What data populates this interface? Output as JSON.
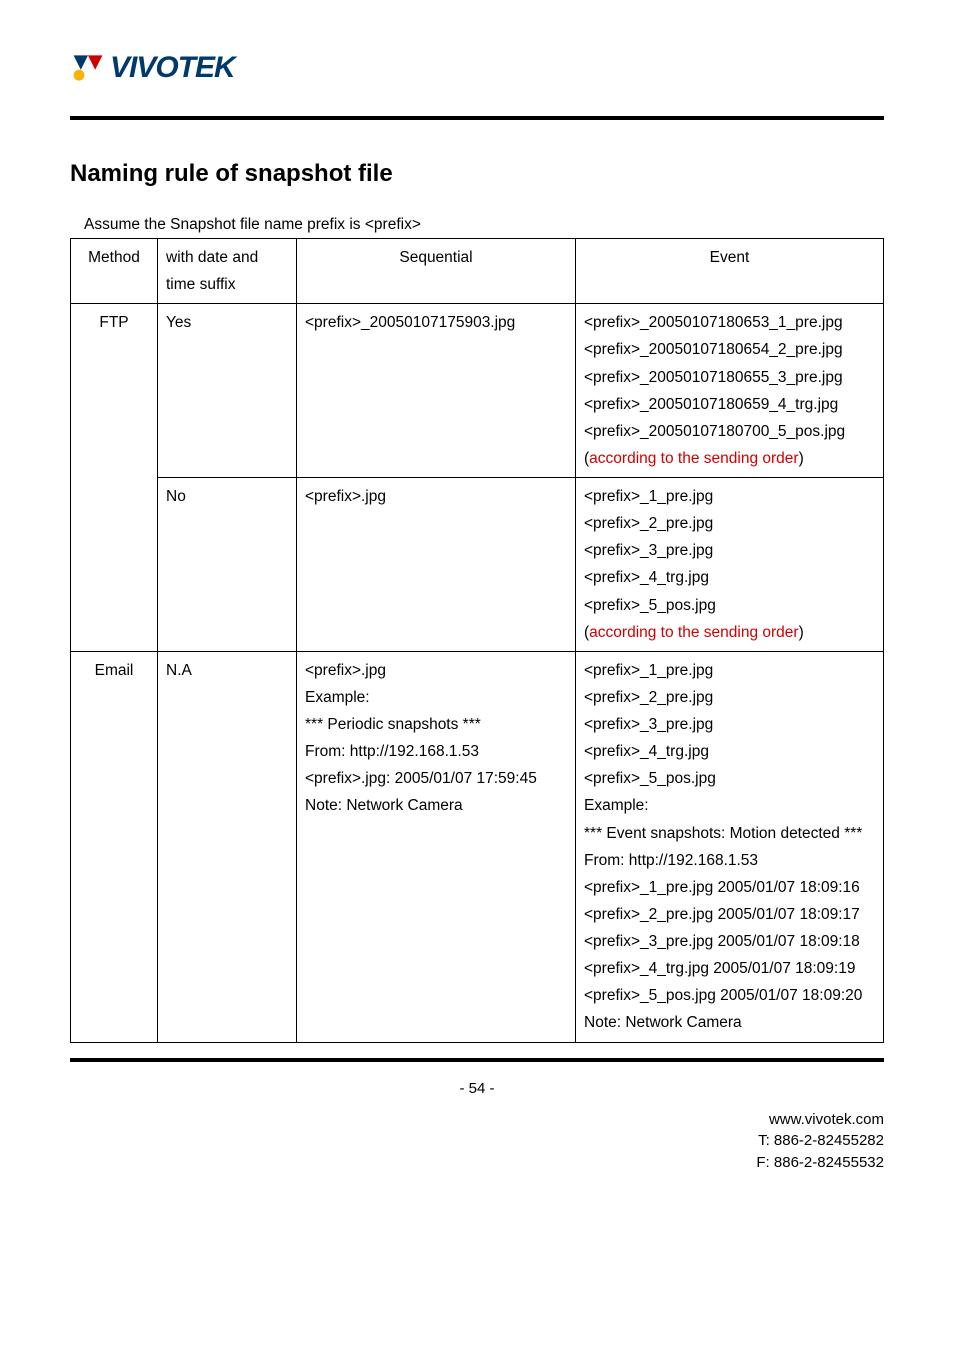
{
  "logo_text": "VIVOTEK",
  "section_title": "Naming rule of snapshot file",
  "assume_text": "Assume the Snapshot file name prefix is <prefix>",
  "table": {
    "headers": {
      "method": "Method",
      "suffix": "with date and time suffix",
      "sequential": "Sequential",
      "event": "Event"
    },
    "rows": [
      {
        "method": "FTP",
        "suffix": "Yes",
        "sequential": "<prefix>_20050107175903.jpg",
        "event_lines": [
          "<prefix>_20050107180653_1_pre.jpg",
          "<prefix>_20050107180654_2_pre.jpg",
          "<prefix>_20050107180655_3_pre.jpg",
          "<prefix>_20050107180659_4_trg.jpg",
          "<prefix>_20050107180700_5_pos.jpg"
        ],
        "event_note_prefix": "(",
        "event_note_red": "according to the sending order",
        "event_note_suffix": ")"
      },
      {
        "suffix": "No",
        "sequential": "<prefix>.jpg",
        "event_lines": [
          "<prefix>_1_pre.jpg",
          "<prefix>_2_pre.jpg",
          "<prefix>_3_pre.jpg",
          "<prefix>_4_trg.jpg",
          "<prefix>_5_pos.jpg"
        ],
        "event_note_prefix": "(",
        "event_note_red": "according to the sending order",
        "event_note_suffix": ")"
      },
      {
        "method": "Email",
        "suffix": "N.A",
        "seq_lines": [
          "<prefix>.jpg",
          "",
          "Example:",
          "*** Periodic snapshots ***",
          "From:   http://192.168.1.53",
          "<prefix>.jpg:  2005/01/07 17:59:45",
          "Note:     Network Camera"
        ],
        "event_lines2": [
          "<prefix>_1_pre.jpg",
          "<prefix>_2_pre.jpg",
          "<prefix>_3_pre.jpg",
          "<prefix>_4_trg.jpg",
          "<prefix>_5_pos.jpg",
          "",
          "Example:",
          "*** Event snapshots: Motion detected ***",
          "From:   http://192.168.1.53",
          "<prefix>_1_pre.jpg   2005/01/07 18:09:16",
          "<prefix>_2_pre.jpg   2005/01/07 18:09:17",
          "<prefix>_3_pre.jpg   2005/01/07 18:09:18",
          "<prefix>_4_trg.jpg     2005/01/07 18:09:19",
          "<prefix>_5_pos.jpg   2005/01/07 18:09:20",
          "Note:     Network Camera"
        ]
      }
    ]
  },
  "page_number": "- 54 -",
  "footer": {
    "url": "www.vivotek.com",
    "tel": "T: 886-2-82455282",
    "fax": "F: 886-2-82455532"
  }
}
